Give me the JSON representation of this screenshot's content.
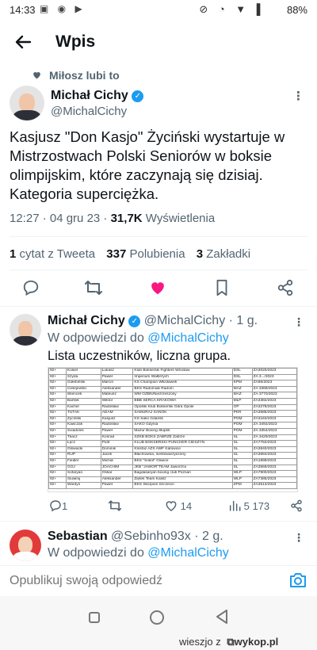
{
  "status_bar": {
    "time": "14:33",
    "battery": "88%"
  },
  "header": {
    "title": "Wpis"
  },
  "social_context": "Miłosz lubi to",
  "main_tweet": {
    "author_name": "Michał Cichy",
    "author_handle": "@MichalCichy",
    "text": "Kasjusz \"Don Kasjo\" Życiński wystartuje w Mistrzostwach Polski Seniorów w boksie olimpijskim, które zaczynają się dzisiaj. Kategoria superciężka.",
    "timestamp": "12:27 · 04 gru 23 · ",
    "views_count": "31,7K",
    "views_label": " Wyświetlenia",
    "stats": {
      "quotes_count": "1",
      "quotes_label": "cytat z Tweeta",
      "likes_count": "337",
      "likes_label": "Polubienia",
      "bookmarks_count": "3",
      "bookmarks_label": "Zakładki"
    },
    "like_color": "#f91880"
  },
  "reply_1": {
    "author_name": "Michał Cichy",
    "author_handle": "@MichalCichy",
    "time": "· 1 g.",
    "reply_to_prefix": "W odpowiedzi do ",
    "reply_to_handle": "@MichalCichy",
    "text": "Lista uczestników, liczna grupa.",
    "attachment_rows": [
      [
        "92+",
        "Kosiel",
        "Łukasz",
        "Klub Bokserski Fighters Wrocław",
        "DŚL",
        "ZA3020/2023"
      ],
      [
        "92+",
        "Szyda",
        "Paweł",
        "Imperium Wałbrzych",
        "DŚL",
        "ZA 3.../2023"
      ],
      [
        "92+",
        "Gołebiński",
        "Marcin",
        "KS Champion Włocławek",
        "KPM",
        "ZA95/2023"
      ],
      [
        "92+",
        "Cielejewski",
        "Aleksander",
        "BKS Radomiak Radom",
        "MAZ",
        "ZA 3388/2023"
      ],
      [
        "92+",
        "Wiencek",
        "Mateusz",
        "WM OŻBN/Niezrzeszony",
        "MAZ",
        "ZA 3770/2023"
      ],
      [
        "92+",
        "Bartnik",
        "Wiktor",
        "BBB SERCA KRAKOWA",
        "MŁP",
        "ZA3382/2023"
      ],
      [
        "92+",
        "Kachel",
        "Radosław",
        "Opolski Klub Bokserski Odra Opole",
        "OP",
        "ZA3278/2023"
      ],
      [
        "92+",
        "TUTAK",
        "ADAM",
        "SAMURAJ SANOK",
        "PKR",
        "ZA3685/2023"
      ],
      [
        "92+",
        "Życiński",
        "Kasjusz",
        "KS Sako Gdańsk",
        "POM",
        "ZA3163/2023"
      ],
      [
        "92+",
        "Kawczak",
        "Radosław",
        "SAKO Gdynia",
        "POM",
        "ZA 3492/2023"
      ],
      [
        "92+",
        "Sviadonis",
        "Paweł",
        "Mazur Boxing Słupsk",
        "POM",
        "ZA 3354/2023"
      ],
      [
        "92+",
        "Tkacz",
        "Konrad",
        "SZKB BOKS ZABRZE   Zabrze",
        "ŚL",
        "ZA 3429/2023"
      ],
      [
        "92+",
        "Łęcż",
        "Piotr",
        "KLUB BOKSERSKI PUNCHER CIESZYN",
        "ŚL",
        "ZA7784/2023"
      ],
      [
        "92+",
        "Główacki",
        "Dominik",
        "Klosfaz AZS AWF Katowice",
        "ŚL",
        "ZA3840/2023"
      ],
      [
        "92+",
        "RUP",
        "Jacek",
        "Błachownia, niestowarzyszony",
        "ŚL",
        "ZA3684/2023"
      ],
      [
        "92+",
        "Fiedler",
        "Michał",
        "BKS \"Sokół\" Gliwice",
        "ŚL",
        "ZA1899/2023"
      ],
      [
        "92+",
        "GOJ",
        "JOACHIM",
        "JKB \"JAWOR\"TEAM Jaworzno",
        "ŚL",
        "ZA3559/2023"
      ],
      [
        "92+",
        "Sofaryan",
        "Oskar",
        "Bagdasaryan boxing club Poznań",
        "WLP",
        "ZA7900/2023"
      ],
      [
        "92+",
        "Siuwinij",
        "Aleksander",
        "Ziętek Team Kalisz",
        "WLP",
        "ZA7385/2023"
      ],
      [
        "92+",
        "Wardyn",
        "Paweł",
        "BKS Skorpion Szczecin",
        "ZPM",
        "ZA3513/2023"
      ]
    ],
    "actions": {
      "replies": "1",
      "likes": "14",
      "views": "5 173"
    }
  },
  "reply_2": {
    "author_name": "Sebastian",
    "author_handle": "@Sebinho93x",
    "time": "· 2 g.",
    "reply_to_prefix": "W odpowiedzi do ",
    "reply_to_handle": "@MichalCichy"
  },
  "reply_composer": {
    "placeholder": "Opublikuj swoją odpowiedź"
  },
  "watermark": {
    "user": "wieszjo",
    "separator": "z",
    "brand": "wykop.pl"
  },
  "colors": {
    "accent": "#1d9bf0",
    "like": "#f91880",
    "muted_text": "#536471"
  }
}
